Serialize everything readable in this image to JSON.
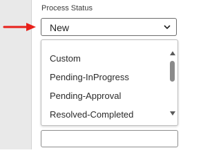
{
  "field": {
    "label": "Process Status",
    "selected_value": "New"
  },
  "dropdown": {
    "options": [
      "Custom",
      "Pending-InProgress",
      "Pending-Approval",
      "Resolved-Completed"
    ]
  },
  "colors": {
    "arrow": "#e8201a",
    "scroll_thumb": "#8a8a8a",
    "gutter": "#e9e9e9"
  },
  "icons": {
    "pointer": "red-arrow-right-icon",
    "select_toggle": "chevron-down-icon",
    "scroll_up": "triangle-up-icon",
    "scroll_down": "triangle-down-icon"
  }
}
